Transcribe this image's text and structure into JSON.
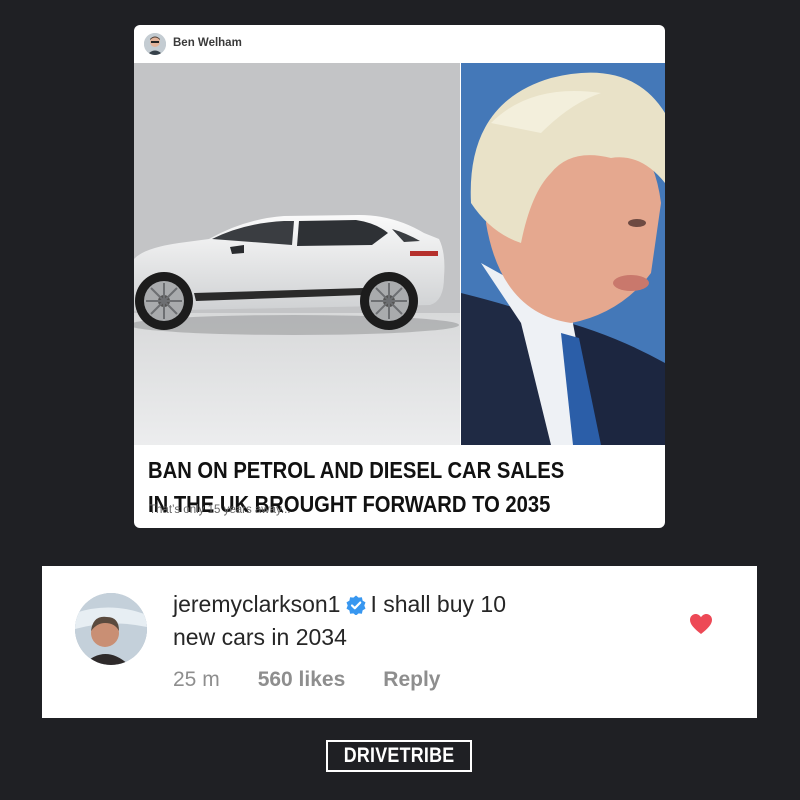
{
  "post": {
    "author": "Ben Welham",
    "headline_line1": "BAN ON PETROL AND DIESEL CAR SALES",
    "headline_line2": "IN THE UK BROUGHT FORWARD TO 2035",
    "subtext": "That’s only 15 years away..."
  },
  "comment": {
    "username": "jeremyclarkson1",
    "text_part1": "I shall buy 10",
    "text_part2": "new cars in 2034",
    "time": "25 m",
    "likes": "560 likes",
    "reply_label": "Reply",
    "liked": true,
    "verified": true,
    "heart_color": "#ed4956",
    "verified_color": "#3897f0"
  },
  "brand": {
    "logo_text": "DRIVETRIBE"
  },
  "icons": [
    "verified-badge-icon",
    "heart-icon"
  ]
}
